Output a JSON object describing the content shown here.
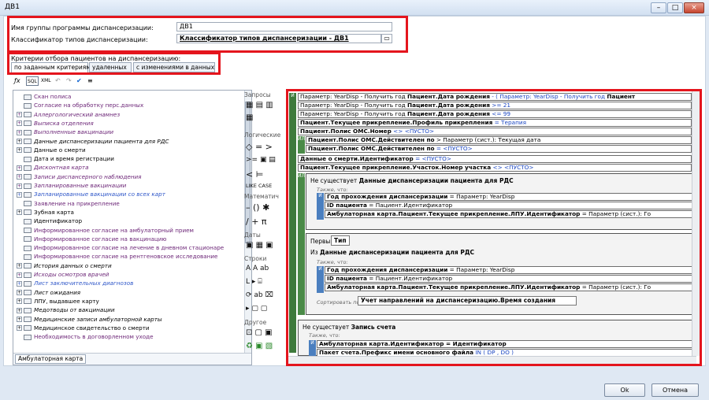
{
  "window": {
    "title": "ДВ1",
    "minimize": "–",
    "maximize": "□",
    "close": "×"
  },
  "form": {
    "group_name_label": "Имя группы программы диспансеризации:",
    "group_name_value": "ДВ1",
    "classifier_label": "Классификатор типов диспансеризации:",
    "classifier_value": "Классификатор типов диспансеризации - ДВ1",
    "criteria_label": "Критерии отбора пациентов на диспансеризацию:"
  },
  "tabs": [
    {
      "label": "по заданным критериям"
    },
    {
      "label": "удаленных"
    },
    {
      "label": "с изменениями в данных"
    }
  ],
  "toolbar": {
    "fx": "ƒx",
    "sql": "SQL",
    "xml": "XML",
    "undo": "↶",
    "redo": "↷",
    "check": "✔",
    "format": "≡"
  },
  "tree": {
    "items": [
      {
        "text": "Скан полиса",
        "style": "purple"
      },
      {
        "text": "Согласие на обработку перс.данных",
        "style": "purple"
      },
      {
        "text": "Аллергологический анамнез",
        "style": "purple italic",
        "exp": "+"
      },
      {
        "text": "Выписка отделения",
        "style": "purple italic",
        "exp": "+"
      },
      {
        "text": "Выполненные вакцинации",
        "style": "purple italic",
        "exp": "+"
      },
      {
        "text": "Данные диспансеризации пациента для РДС",
        "style": "italic",
        "exp": "+"
      },
      {
        "text": "Данные о смерти",
        "style": "",
        "exp": "+"
      },
      {
        "text": "Дата и время регистрации",
        "style": ""
      },
      {
        "text": "Дисконтная карта",
        "style": "purple italic",
        "exp": "+"
      },
      {
        "text": "Записи диспансерного наблюдения",
        "style": "purple italic",
        "exp": "+"
      },
      {
        "text": "Запланированные вакцинации",
        "style": "purple italic",
        "exp": "+"
      },
      {
        "text": "Запланированные вакцинации со всех карт",
        "style": "blue italic",
        "exp": "+"
      },
      {
        "text": "Заявление на прикрепление",
        "style": "purple"
      },
      {
        "text": "Зубная карта",
        "style": "",
        "exp": "+"
      },
      {
        "text": "Идентификатор",
        "style": ""
      },
      {
        "text": "Информированное согласие на амбулаторный прием",
        "style": "purple"
      },
      {
        "text": "Информированное согласие на вакцинацию",
        "style": "purple"
      },
      {
        "text": "Информированное согласие на лечение в дневном стационаре",
        "style": "purple"
      },
      {
        "text": "Информированное согласие на рентгеновское исследование",
        "style": "purple"
      },
      {
        "text": "История данных о смерти",
        "style": "italic",
        "exp": "+"
      },
      {
        "text": "Исходы осмотров врачей",
        "style": "purple italic",
        "exp": "+"
      },
      {
        "text": "Лист заключительных диагнозов",
        "style": "blue italic",
        "exp": "+"
      },
      {
        "text": "Лист ожидания",
        "style": "italic",
        "exp": "+"
      },
      {
        "text": "ЛПУ, выдавшее карту",
        "style": "",
        "exp": "+"
      },
      {
        "text": "Медотводы от вакцинации",
        "style": "italic",
        "exp": "+"
      },
      {
        "text": "Медицинские записи амбулаторной карты",
        "style": "italic",
        "exp": "+"
      },
      {
        "text": "Медицинское свидетельство о смерти",
        "style": "",
        "exp": "+"
      },
      {
        "text": "Необходимость в договорленном уходе",
        "style": "purple"
      }
    ],
    "bottom_tab": "Амбулаторная карта"
  },
  "palette": {
    "queries": "Запросы",
    "logical": "Логические",
    "math": "Математич",
    "dates": "Даты",
    "strings": "Строки",
    "other": "Другое",
    "ops_row1": "◇ = >",
    "ops_row2": ">= ▣ ▤",
    "ops_row3": "< ⊨",
    "ops_row4": "LIKE CASE",
    "math_row1": "– () ✱",
    "math_row2": "/ + π",
    "str_row1": "A  A  ab",
    "str_row2": "L ▸ ⌸"
  },
  "canvas": {
    "rows": [
      {
        "a": "Параметр: YearDisp - Получить год ",
        "b": "Пациент.Дата рождения",
        "c": " - ( Параметр: YearDisp - Получить год ",
        "d": "Пациент"
      },
      {
        "a": "Параметр: YearDisp - Получить год ",
        "b": "Пациент.Дата рождения",
        "c": " >= 21"
      },
      {
        "a": "Параметр: YearDisp - Получить год ",
        "b": "Пациент.Дата рождения",
        "c": " <= 99"
      },
      {
        "a": "",
        "b": "Пациент.Текущее прикрепление.Профиль прикрепления",
        "c": " = Терапия"
      },
      {
        "a": "",
        "b": "Пациент.Полис ОМС.Номер",
        "c": " <> <ПУСТО>"
      }
    ],
    "or1": {
      "bar": "ИЛИ",
      "r1b": "Пациент.Полис ОМС.Действителен по",
      "r1c": " > Параметр (сист.): Текущая дата",
      "r2b": "Пациент.Полис ОМС.Действителен по",
      "r2c": " = <ПУСТО>"
    },
    "rows2": [
      {
        "b": "Данные о смерти.Идентификатор",
        "c": " = <ПУСТО>"
      },
      {
        "b": "Пациент.Текущее прикрепление.Участок.Номер участка",
        "c": " <> <ПУСТО>"
      }
    ],
    "block1": {
      "prefix": "Не существует ",
      "title": "Данные диспансеризации пациента для РДС",
      "also": "Также, что:",
      "r1b": "Год прохождения диспансеризации",
      "r1c": " = Параметр: YearDisp",
      "r2b": "ID пациента",
      "r2c": " = Пациент.Идентификатор",
      "r3b": "Амбулаторная карта.Пациент.Текущее прикрепление.ЛПУ.Идентификатор",
      "r3c": " = Параметр (сист.): Го",
      "and_bar": "И"
    },
    "block2": {
      "first": "Первый",
      "type": "Тип",
      "from": "Из ",
      "title": "Данные диспансеризации пациента для РДС",
      "also": "Также, что:",
      "r1b": "Год прохождения диспансеризации",
      "r1c": " = Параметр: YearDisp",
      "r2b": "ID пациента",
      "r2c": " = Пациент.Идентификатор",
      "r3b": "Амбулаторная карта.Пациент.Текущее прикрепление.ЛПУ.Идентификатор",
      "r3c": " = Параметр (сист.): Го",
      "sort_label": "Сортировать по:",
      "sort_value": "Учет направлений на диспансеризацию.Время создания",
      "and_bar": "И"
    },
    "or2_bar": "ИЛИ",
    "block3": {
      "prefix": "Не существует ",
      "title": "Запись счета",
      "also": "Также, что:",
      "r1b": "Амбулаторная карта.Идентификатор",
      "r1c": " = Идентификатор",
      "r2b": "Пакет счета.Префикс имени основного файла",
      "r2c": " IN ( DP , DO )",
      "and_bar": "И"
    },
    "outer_and": "И"
  },
  "buttons": {
    "ok": "Ok",
    "cancel": "Отмена"
  }
}
